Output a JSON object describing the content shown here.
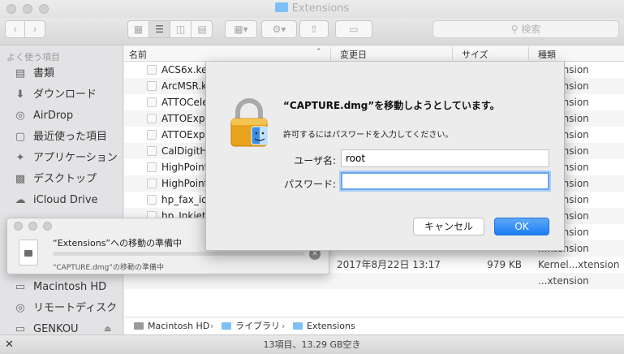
{
  "window": {
    "title": "Extensions"
  },
  "toolbar": {
    "search_placeholder": "検索",
    "search_icon": "magnifier-icon"
  },
  "sidebar": {
    "section_title": "よく使う項目",
    "items": [
      {
        "label": "書類",
        "icon": "document-icon"
      },
      {
        "label": "ダウンロード",
        "icon": "download-icon"
      },
      {
        "label": "AirDrop",
        "icon": "airdrop-icon"
      },
      {
        "label": "最近使った項目",
        "icon": "recent-icon"
      },
      {
        "label": "アプリケーション",
        "icon": "applications-icon"
      },
      {
        "label": "デスクトップ",
        "icon": "desktop-icon"
      },
      {
        "label": "iCloud Drive",
        "icon": "cloud-icon"
      }
    ],
    "devices": [
      {
        "label": "Macintosh HD",
        "icon": "harddisk-icon"
      },
      {
        "label": "リモートディスク",
        "icon": "disc-icon"
      },
      {
        "label": "GENKOU",
        "icon": "harddisk-icon"
      }
    ]
  },
  "table": {
    "columns": {
      "name": "名前",
      "date": "変更日",
      "size": "サイズ",
      "kind": "種類"
    },
    "rows": [
      {
        "name": "ACS6x.ke",
        "date": "",
        "size": "",
        "kind": "...xtension"
      },
      {
        "name": "ArcMSR.k",
        "date": "",
        "size": "",
        "kind": "...xtension"
      },
      {
        "name": "ATTOCele",
        "date": "",
        "size": "",
        "kind": "...xtension"
      },
      {
        "name": "ATTOExpr",
        "date": "",
        "size": "",
        "kind": "...xtension"
      },
      {
        "name": "ATTOExpr",
        "date": "",
        "size": "",
        "kind": "...xtension"
      },
      {
        "name": "CalDigitH",
        "date": "",
        "size": "",
        "kind": "...xtension"
      },
      {
        "name": "HighPoint",
        "date": "",
        "size": "",
        "kind": "...xtension"
      },
      {
        "name": "HighPoint",
        "date": "",
        "size": "",
        "kind": "...xtension"
      },
      {
        "name": "hp_fax_io.",
        "date": "",
        "size": "",
        "kind": "...xtension"
      },
      {
        "name": "hp_Inkjet1",
        "date": "",
        "size": "",
        "kind": "...xtension"
      },
      {
        "name": "",
        "date": "",
        "size": "",
        "kind": "...xtension"
      },
      {
        "name": "",
        "date": "",
        "size": "",
        "kind": "...xtension"
      },
      {
        "name": "",
        "date": "2017年8月22日 13:17",
        "size": "979 KB",
        "kind": "Kernel...xtension"
      },
      {
        "name": "",
        "date": "",
        "size": "",
        "kind": "...xtension"
      }
    ]
  },
  "pathbar": {
    "items": [
      "Macintosh HD",
      "ライブラリ",
      "Extensions"
    ]
  },
  "status": {
    "text": "13項目、13.29 GB空き"
  },
  "dialog": {
    "message": "“CAPTURE.dmg”を移動しようとしています。",
    "subtext": "許可するにはパスワードを入力してください。",
    "username_label": "ユーザ名:",
    "username_value": "root",
    "password_label": "パスワード:",
    "password_value": "",
    "cancel_label": "キャンセル",
    "ok_label": "OK",
    "accent_color": "#1b7ef3"
  },
  "progress": {
    "title": "“Extensions”への移動の準備中",
    "subtitle": "“CAPTURE.dmg”の移動の準備中",
    "fraction": 0.0
  }
}
